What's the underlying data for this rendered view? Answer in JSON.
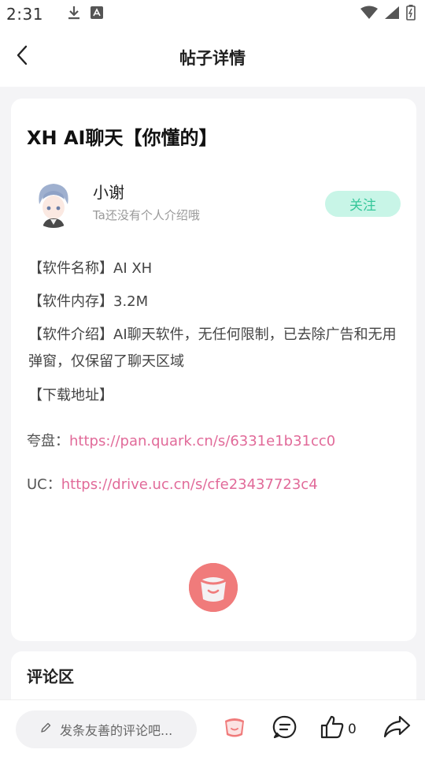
{
  "status_bar": {
    "time": "2:31"
  },
  "header": {
    "title": "帖子详情"
  },
  "post": {
    "title": "XH AI聊天【你懂的】",
    "author": {
      "name": "小谢",
      "bio": "Ta还没有个人介绍哦"
    },
    "follow_label": "关注",
    "lines": [
      "【软件名称】AI XH",
      "【软件内存】3.2M",
      "【软件介绍】AI聊天软件，无任何限制，已去除广告和无用弹窗，仅保留了聊天区域",
      "【下载地址】"
    ],
    "links": [
      {
        "label": "夸盘：",
        "url": "https://pan.quark.cn/s/6331e1b31cc0"
      },
      {
        "label": "UC：",
        "url": "https://drive.uc.cn/s/cfe23437723c4"
      }
    ]
  },
  "comments": {
    "title": "评论区"
  },
  "bottom_bar": {
    "comment_placeholder": "发条友善的评论吧...",
    "like_count": "0"
  },
  "colors": {
    "accent_follow_bg": "#c8f5e7",
    "accent_follow_text": "#36c79a",
    "link": "#e16a99",
    "logo": "#f07b7b"
  },
  "icons": {
    "back": "chevron-left-icon",
    "download": "download-icon",
    "app_notification": "app-notification-icon",
    "wifi": "wifi-icon",
    "signal": "signal-icon",
    "battery": "battery-icon",
    "edit": "pencil-icon",
    "logo": "app-logo-icon",
    "comment": "comment-icon",
    "like": "thumbs-up-icon",
    "share": "share-icon"
  }
}
